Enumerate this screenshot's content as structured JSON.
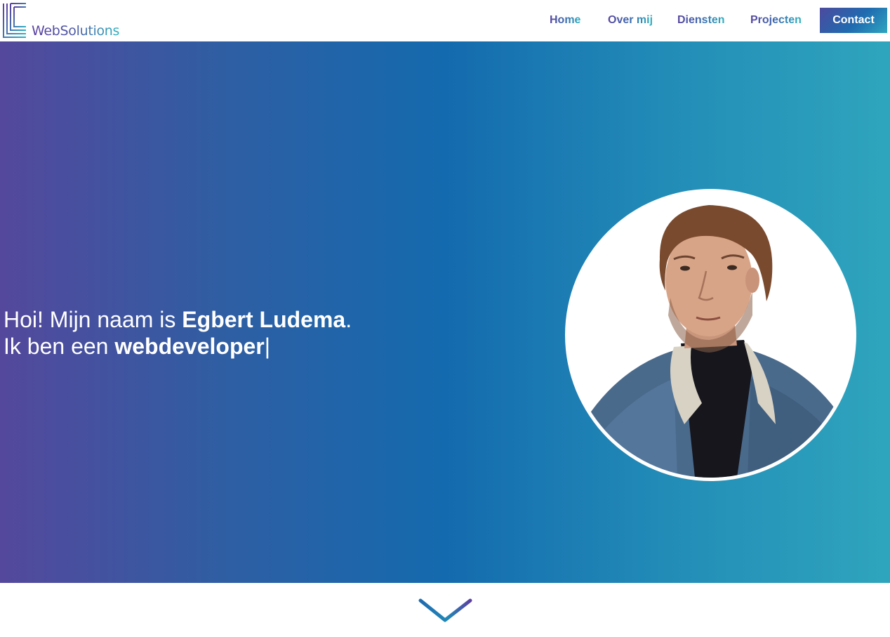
{
  "brand": {
    "logo_text": "WebSolutions",
    "colors": {
      "purple": "#54489c",
      "blue": "#146aae",
      "teal": "#2fa5bd"
    }
  },
  "nav": {
    "items": [
      {
        "label": "Home"
      },
      {
        "label": "Over mij"
      },
      {
        "label": "Diensten"
      },
      {
        "label": "Projecten"
      }
    ],
    "contact_label": "Contact"
  },
  "hero": {
    "line1_prefix": "Hoi! Mijn naam is ",
    "line1_name": "Egbert Ludema",
    "line1_suffix": ".",
    "line2_prefix": "Ik ben een ",
    "line2_role": "webdeveloper",
    "line2_cursor": "|",
    "portrait_icon": "person-portrait"
  },
  "footer": {
    "scroll_icon": "chevron-down-icon"
  }
}
